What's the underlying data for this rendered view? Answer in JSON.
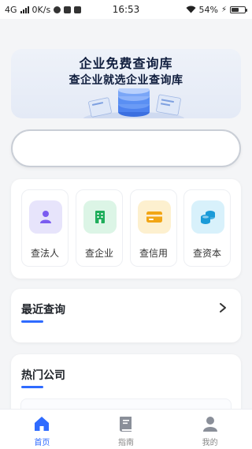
{
  "status_bar": {
    "network": "4G",
    "speed": "0K/s",
    "time": "16:53",
    "battery_text": "54%",
    "battery_level": 0.54
  },
  "banner": {
    "line1": "企业免费查询库",
    "line2": "查企业就选企业查询库"
  },
  "search": {
    "placeholder": "",
    "value": ""
  },
  "actions": [
    {
      "label": "查法人",
      "icon": "person-icon",
      "color": "#7b5cf0",
      "bg": "#e7e4fb"
    },
    {
      "label": "查企业",
      "icon": "building-icon",
      "color": "#1fae5b",
      "bg": "#dcf5e6"
    },
    {
      "label": "查信用",
      "icon": "credit-card-icon",
      "color": "#f2a615",
      "bg": "#fdf0cf"
    },
    {
      "label": "查资本",
      "icon": "coins-icon",
      "color": "#1b9bd8",
      "bg": "#d8f1fb"
    }
  ],
  "recent": {
    "title": "最近查询"
  },
  "hot": {
    "title": "热门公司"
  },
  "nav": [
    {
      "label": "首页",
      "icon": "home-icon",
      "active": true
    },
    {
      "label": "指南",
      "icon": "book-icon",
      "active": false
    },
    {
      "label": "我的",
      "icon": "user-icon",
      "active": false
    }
  ],
  "colors": {
    "accent": "#2f6bff",
    "inactive": "#8a8f99"
  }
}
